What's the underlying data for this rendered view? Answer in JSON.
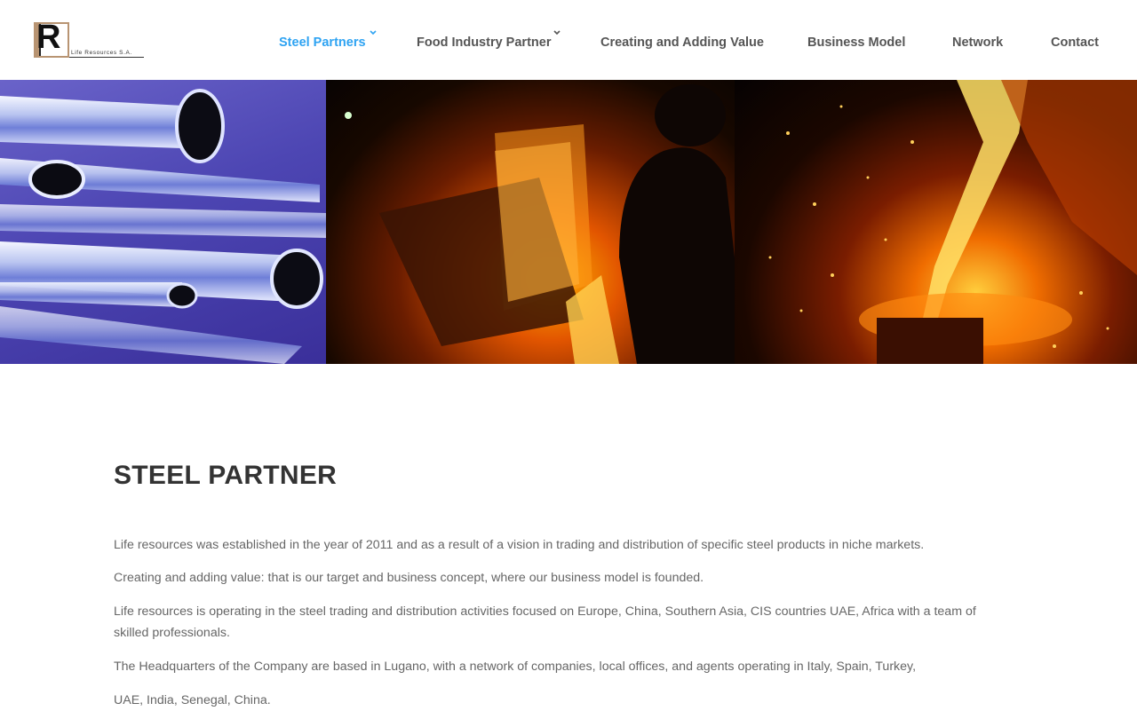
{
  "logo": {
    "letter": "R",
    "text": "Life Resources S.A."
  },
  "nav": {
    "items": [
      {
        "label": "Steel Partners",
        "active": true,
        "has_dropdown": true
      },
      {
        "label": "Food Industry Partner",
        "active": false,
        "has_dropdown": true
      },
      {
        "label": "Creating and Adding Value",
        "active": false,
        "has_dropdown": false
      },
      {
        "label": "Business Model",
        "active": false,
        "has_dropdown": false
      },
      {
        "label": "Network",
        "active": false,
        "has_dropdown": false
      },
      {
        "label": "Contact",
        "active": false,
        "has_dropdown": false
      }
    ]
  },
  "hero": {
    "panels": [
      "steel-tubes-image",
      "steel-foundry-worker-image",
      "molten-steel-pour-image"
    ]
  },
  "main": {
    "title": "STEEL PARTNER",
    "paragraphs": [
      "Life resources was established in the year of 2011 and as a result of a vision in trading and distribution of specific steel products in niche markets.",
      "Creating and adding value: that is our target and business concept, where our business model is founded.",
      "Life resources is operating in the steel trading and distribution activities focused on Europe, China, Southern Asia, CIS countries UAE, Africa with a team of skilled professionals.",
      "The Headquarters of the Company are based in Lugano, with a network of companies, local offices, and agents operating in Italy, Spain, Turkey,",
      "UAE, India, Senegal, China."
    ]
  },
  "colors": {
    "accent": "#2ea3f2",
    "nav_text": "#555555",
    "heading": "#333333",
    "body_text": "#666666"
  }
}
